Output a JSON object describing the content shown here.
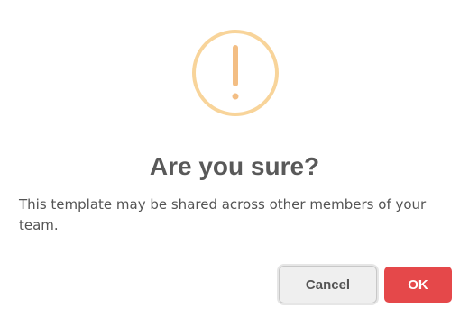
{
  "dialog": {
    "icon": "warning-exclamation-icon",
    "icon_color": "#f8c486",
    "title": "Are you sure?",
    "message": "This template may be shared across other members of your team.",
    "cancel_label": "Cancel",
    "ok_label": "OK",
    "ok_color": "#e5484a"
  }
}
